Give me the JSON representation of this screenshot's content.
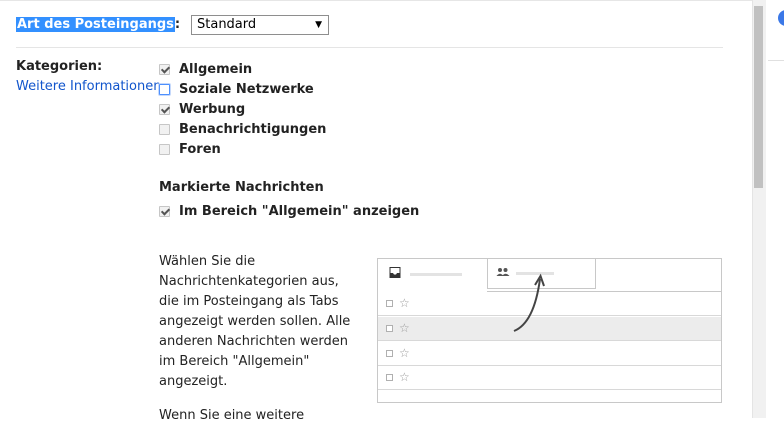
{
  "inbox_type": {
    "label_selected": "Art des Posteingangs",
    "label_suffix": ":",
    "select_value": "Standard"
  },
  "categories": {
    "label": "Kategorien:",
    "more_link": "Weitere Informationen",
    "items": [
      {
        "label": "Allgemein",
        "checked": true
      },
      {
        "label": "Soziale Netzwerke",
        "checked": false
      },
      {
        "label": "Werbung",
        "checked": true
      },
      {
        "label": "Benachrichtigungen",
        "checked": false
      },
      {
        "label": "Foren",
        "checked": false
      }
    ]
  },
  "starred": {
    "title": "Markierte Nachrichten",
    "option_label": "Im Bereich \"Allgemein\" anzeigen"
  },
  "description": {
    "lines": [
      "Wählen Sie die",
      "Nachrichtenkategorien aus,",
      "die im Posteingang als Tabs",
      "angezeigt werden sollen. Alle",
      "anderen Nachrichten werden",
      "im Bereich \"Allgemein\"",
      "angezeigt."
    ],
    "next_partial": "Wenn Sie eine weitere"
  },
  "illustration": {
    "tab1_icon": "inbox-tray-icon",
    "tab2_icon": "people-icon",
    "star_glyph": "☆",
    "rows": 4
  },
  "colors": {
    "link": "#1155cc",
    "selection": "#3390ff",
    "accent_blue": "#3b78e7"
  }
}
